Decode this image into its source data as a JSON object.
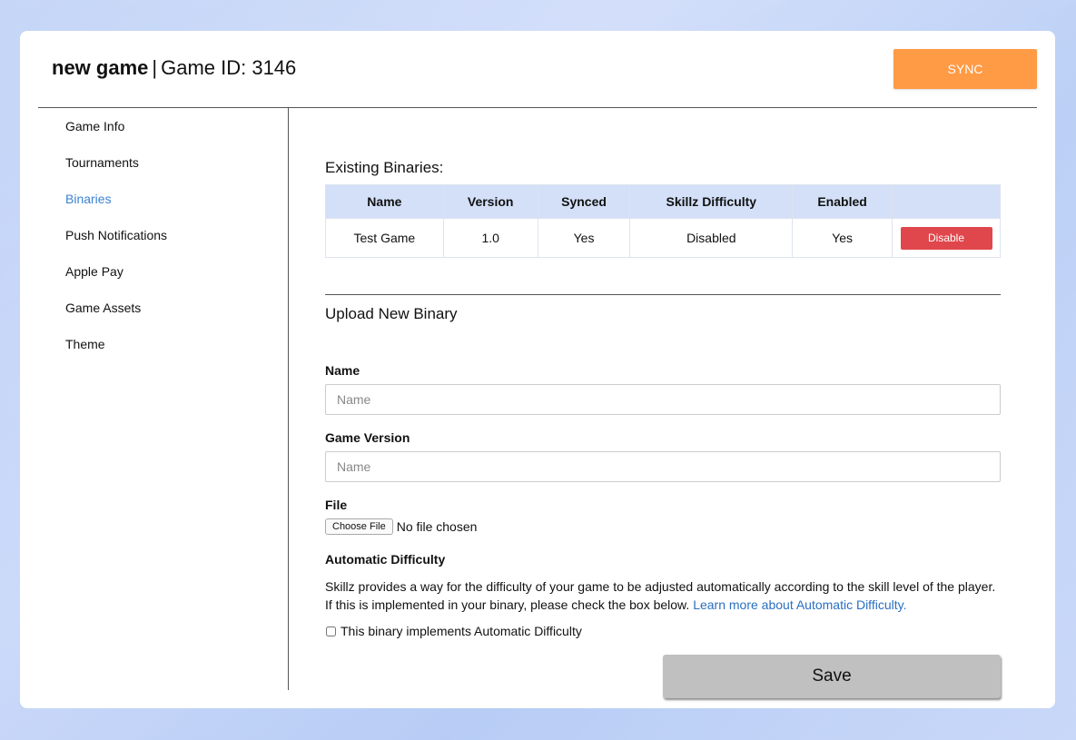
{
  "header": {
    "game_name": "new game",
    "separator": "|",
    "game_id_label": "Game ID: 3146",
    "sync_label": "SYNC"
  },
  "colors": {
    "accent_orange": "#ff9a45",
    "active_link": "#3a83d1",
    "danger": "#e0474c",
    "table_header": "#d3e0f8"
  },
  "sidebar": {
    "items": [
      {
        "label": "Game Info",
        "active": false
      },
      {
        "label": "Tournaments",
        "active": false
      },
      {
        "label": "Binaries",
        "active": true
      },
      {
        "label": "Push Notifications",
        "active": false
      },
      {
        "label": "Apple Pay",
        "active": false
      },
      {
        "label": "Game Assets",
        "active": false
      },
      {
        "label": "Theme",
        "active": false
      }
    ]
  },
  "existing": {
    "title": "Existing Binaries:",
    "columns": [
      "Name",
      "Version",
      "Synced",
      "Skillz Difficulty",
      "Enabled",
      ""
    ],
    "rows": [
      {
        "name": "Test Game",
        "version": "1.0",
        "synced": "Yes",
        "difficulty": "Disabled",
        "enabled": "Yes",
        "action_label": "Disable"
      }
    ]
  },
  "upload": {
    "title": "Upload New Binary",
    "name_label": "Name",
    "name_placeholder": "Name",
    "version_label": "Game Version",
    "version_placeholder": "Name",
    "file_label": "File",
    "choose_file_label": "Choose File",
    "no_file_text": "No file chosen",
    "auto_difficulty_label": "Automatic Difficulty",
    "description_line1": "Skillz provides a way for the difficulty of your game to be adjusted automatically according to the skill level of the player.",
    "description_line2": "If this is implemented in your binary, please check the box below.",
    "learn_more_link": "Learn more about Automatic Difficulty.",
    "checkbox_label": "This binary implements Automatic Difficulty",
    "checkbox_checked": false,
    "save_label": "Save"
  }
}
